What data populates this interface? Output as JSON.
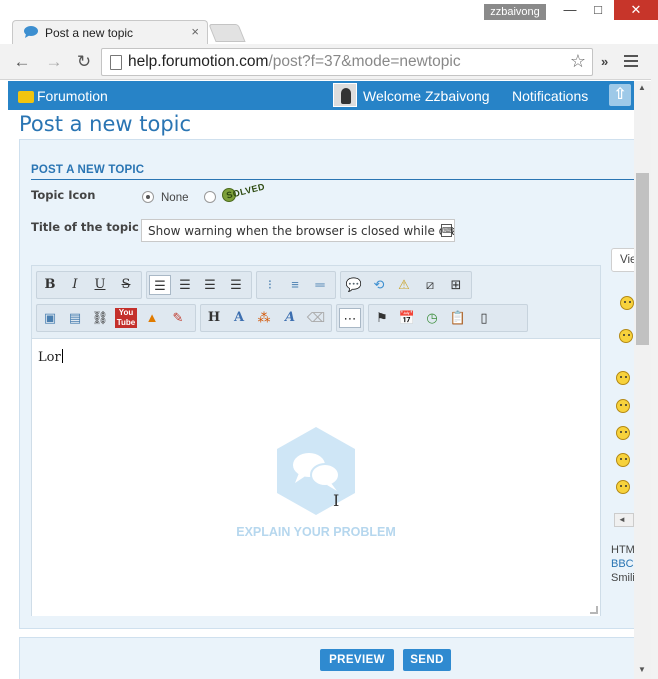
{
  "browser": {
    "tab_title": "Post a new topic",
    "tab_close": "×",
    "user_badge": "zzbaivong",
    "url_host": "help.forumotion.com",
    "url_path": "/post?f=37&mode=newtopic",
    "window_min": "—",
    "window_max": "□",
    "window_close": "✕",
    "ext_chevron": "»"
  },
  "forum": {
    "brand": "Forumotion",
    "welcome": "Welcome Zzbaivong",
    "notifications": "Notifications",
    "page_title": "Post a new topic"
  },
  "form": {
    "section_heading": "POST A NEW TOPIC",
    "topic_icon_label": "Topic Icon",
    "icon_none_label": "None",
    "icon_solved_text": "SOLVED",
    "topic_title_label": "Title of the topic",
    "topic_title_value": "Show warning when the browser is closed while drafting"
  },
  "toolbar": {
    "bold": "B",
    "italic": "I",
    "underline": "U",
    "strike": "S",
    "heading": "H",
    "font_size": "A",
    "font_face": "A"
  },
  "editor": {
    "content": "Lor",
    "watermark_caption": "EXPLAIN YOUR PROBLEM"
  },
  "side": {
    "view_select": "View",
    "html_mode": "HTML",
    "bbcode_mode": "BBCode",
    "smilies_mode": "Smilies",
    "scroll_left": "◄"
  },
  "actions": {
    "preview": "PREVIEW",
    "send": "SEND"
  },
  "colors": {
    "topbar": "#2783c7",
    "accent": "#2a75b3",
    "button": "#2f8ad0",
    "panel_bg": "#eaf3fa"
  }
}
